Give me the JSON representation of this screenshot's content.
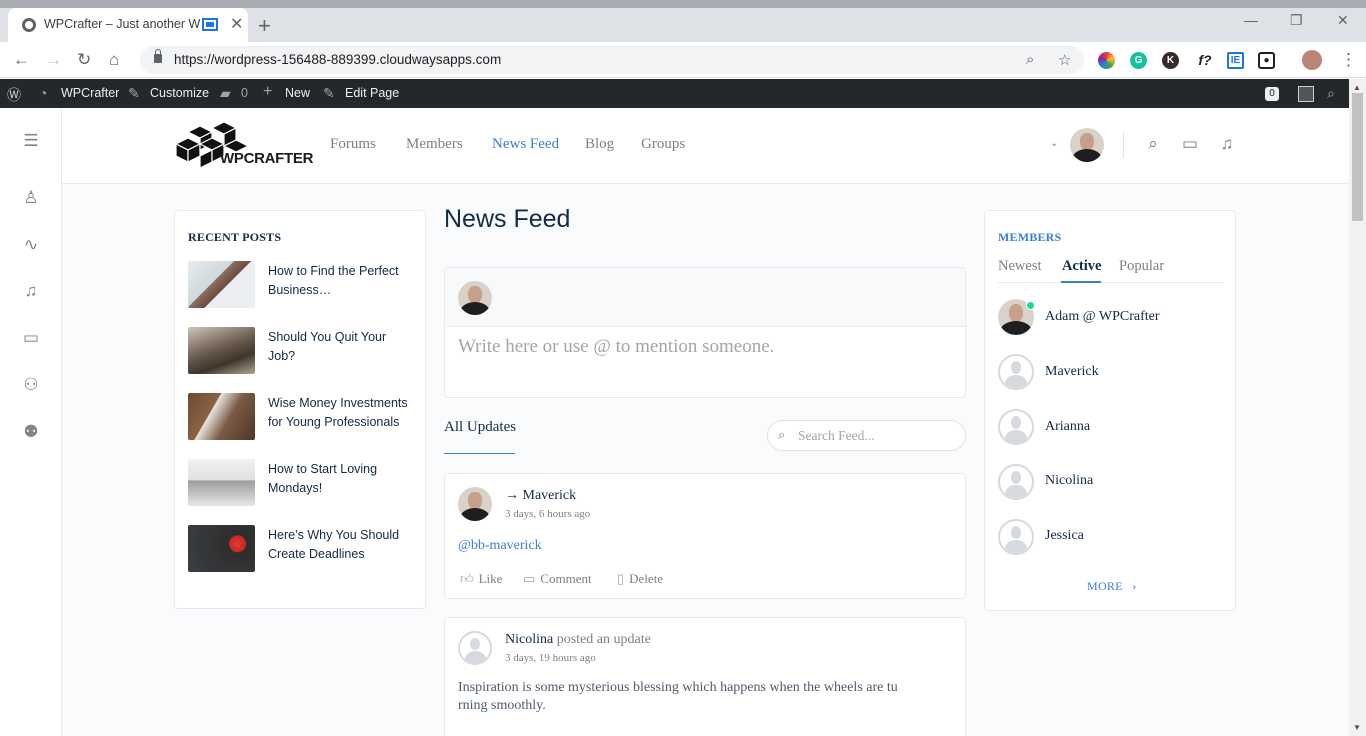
{
  "browser": {
    "tab_title": "WPCrafter – Just another Wo",
    "url": "https://wordpress-156488-889399.cloudwaysapps.com"
  },
  "adminbar": {
    "site_name": "WPCrafter",
    "customize": "Customize",
    "comments_count": "0",
    "new": "New",
    "edit_page": "Edit Page",
    "updates_badge": "0"
  },
  "header": {
    "logo_text": "WPCRAFTER",
    "nav": [
      "Forums",
      "Members",
      "News Feed",
      "Blog",
      "Groups"
    ],
    "active_nav": "News Feed"
  },
  "recent_posts": {
    "title": "RECENT POSTS",
    "items": [
      {
        "title": "How to Find the Perfect Business…"
      },
      {
        "title": "Should You Quit Your Job?"
      },
      {
        "title": "Wise Money Investments for Young Professionals"
      },
      {
        "title": "How to Start Loving Mondays!"
      },
      {
        "title": "Here’s Why You Should Create Deadlines"
      }
    ]
  },
  "feed": {
    "title": "News Feed",
    "composer_placeholder": "Write here or use @ to mention someone.",
    "filter_tab": "All Updates",
    "search_placeholder": "Search Feed...",
    "activities": [
      {
        "name": "→ Maverick",
        "action": "",
        "time": "3 days, 6 hours ago",
        "body": "@bb-maverick",
        "buttons": {
          "like": "Like",
          "comment": "Comment",
          "delete": "Delete"
        }
      },
      {
        "name": "Nicolina",
        "action": "posted an update",
        "time": "3 days, 19 hours ago",
        "body_line1": "Inspiration is some mysterious blessing which happens when the wheels are tu",
        "body_line2": "rning smoothly."
      }
    ]
  },
  "members": {
    "title": "MEMBERS",
    "tabs": [
      "Newest",
      "Active",
      "Popular"
    ],
    "active_tab": "Active",
    "list": [
      "Adam @ WPCrafter",
      "Maverick",
      "Arianna",
      "Nicolina",
      "Jessica"
    ],
    "more": "MORE"
  },
  "colors": {
    "accent": "#3b7ed6",
    "online": "#1cd991",
    "adminbar": "#23282d"
  }
}
